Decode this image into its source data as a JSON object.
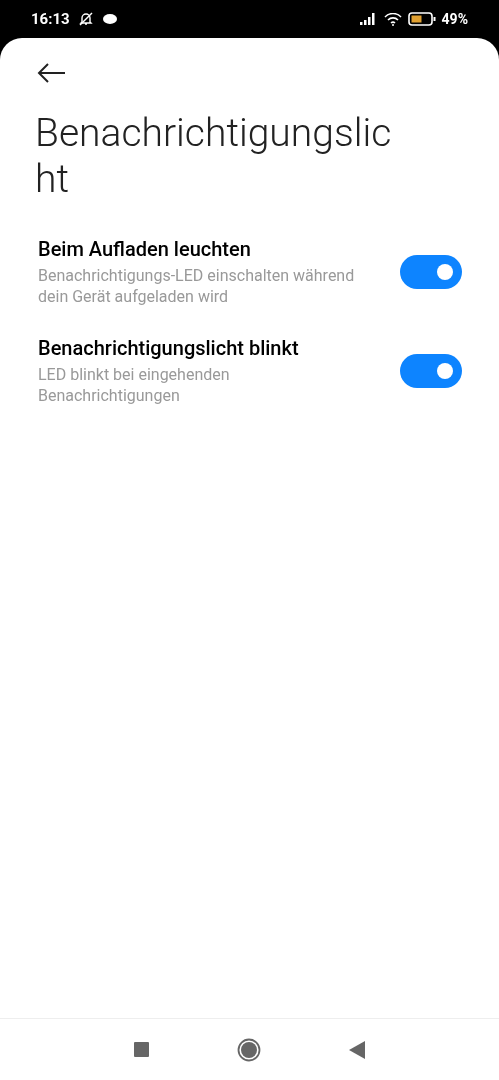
{
  "status_bar": {
    "time": "16:13",
    "battery": "49%"
  },
  "title": "Benachrichtigungslicht",
  "settings": [
    {
      "title": "Beim Aufladen leuchten",
      "description": "Benachrichtigungs-LED einschalten während dein Gerät aufgeladen wird",
      "on": true
    },
    {
      "title": "Benachrichtigungslicht blinkt",
      "description": "LED blinkt bei eingehenden Benachrichtigungen",
      "on": true
    }
  ]
}
